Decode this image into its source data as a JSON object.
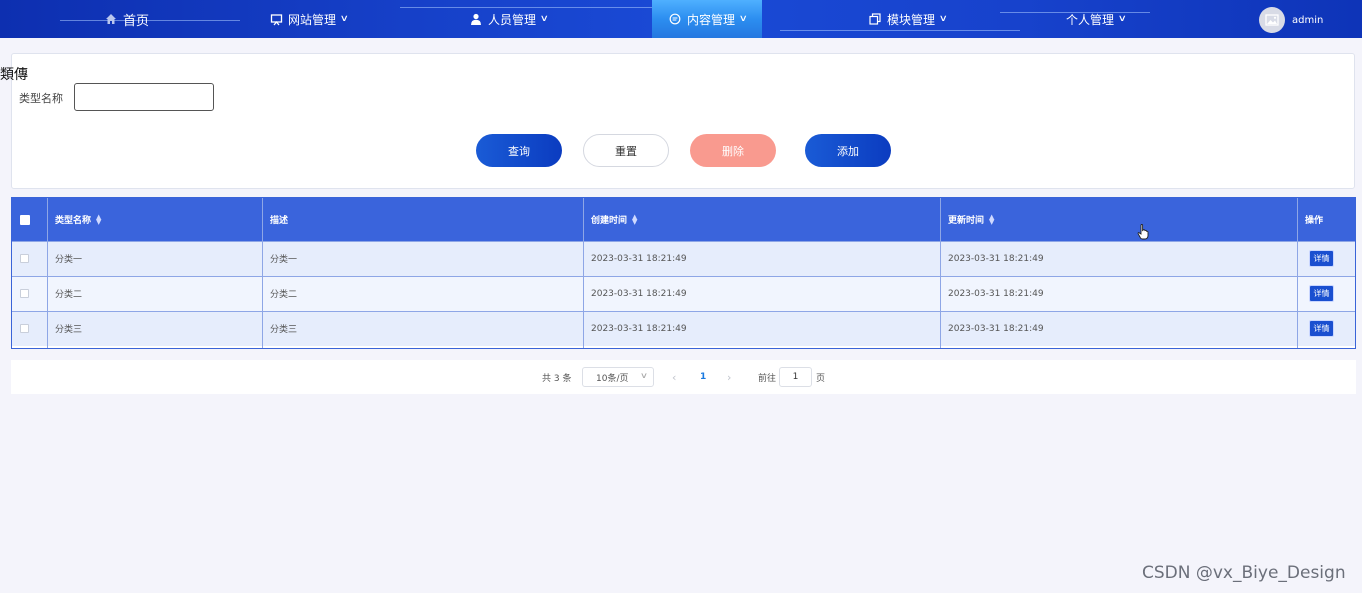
{
  "nav": {
    "home": "首页",
    "items": [
      "网站管理",
      "人员管理",
      "内容管理",
      "模块管理",
      "个人管理"
    ],
    "active": "内容管理",
    "user": "admin"
  },
  "search": {
    "garbled_title": "類傳",
    "label": "类型名称",
    "value": "",
    "buttons": {
      "query": "查询",
      "reset": "重置",
      "delete": "删除",
      "add": "添加"
    }
  },
  "table": {
    "columns": {
      "name": "类型名称",
      "desc": "描述",
      "created": "创建时间",
      "updated": "更新时间",
      "ops": "操作"
    },
    "rows": [
      {
        "name": "分类一",
        "desc": "分类一",
        "created": "2023-03-31 18:21:49",
        "updated": "2023-03-31 18:21:49",
        "action": "详情"
      },
      {
        "name": "分类二",
        "desc": "分类二",
        "created": "2023-03-31 18:21:49",
        "updated": "2023-03-31 18:21:49",
        "action": "详情"
      },
      {
        "name": "分类三",
        "desc": "分类三",
        "created": "2023-03-31 18:21:49",
        "updated": "2023-03-31 18:21:49",
        "action": "详情"
      }
    ]
  },
  "pagination": {
    "total": "共 3 条",
    "page_size": "10条/页",
    "current": "1",
    "goto_label": "前往",
    "goto_value": "1",
    "page_unit": "页"
  },
  "watermark": "CSDN @vx_Biye_Design",
  "colors": {
    "nav": "#1640c8",
    "active_tab": "#2c8ef0",
    "primary": "#1a4fd0",
    "danger": "#f99a8f",
    "table_head": "#3a64dc"
  }
}
